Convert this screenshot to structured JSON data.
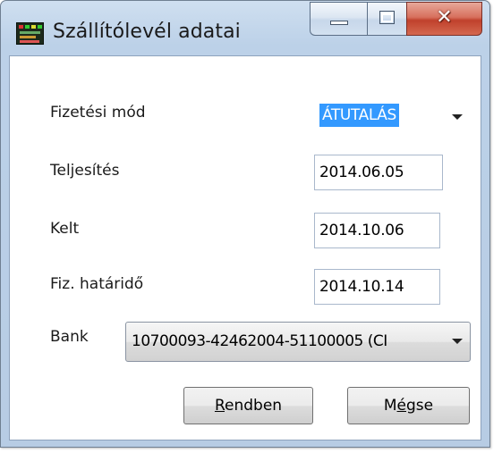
{
  "window": {
    "title": "Szállítólevél adatai",
    "close_glyph": "✕",
    "icons": {
      "app": "app-icon",
      "minimize": "minimize-icon",
      "maximize": "maximize-icon",
      "close": "close-icon"
    }
  },
  "form": {
    "payment_method": {
      "label": "Fizetési mód",
      "value": "ÁTUTALÁS"
    },
    "fulfillment": {
      "label": "Teljesítés",
      "value": "2014.06.05"
    },
    "issued": {
      "label": "Kelt",
      "value": "2014.10.06"
    },
    "due_date": {
      "label": "Fiz. határidő",
      "value": "2014.10.14"
    },
    "bank": {
      "label": "Bank",
      "value": "10700093-42462004-51100005 (CI"
    }
  },
  "buttons": {
    "ok": {
      "accel": "R",
      "rest": "endben"
    },
    "cancel": {
      "before": "M",
      "accel": "é",
      "rest": "gse"
    }
  },
  "colors": {
    "selection": "#3399ff",
    "close_button": "#c0412c",
    "frame": "#b7cce4"
  }
}
